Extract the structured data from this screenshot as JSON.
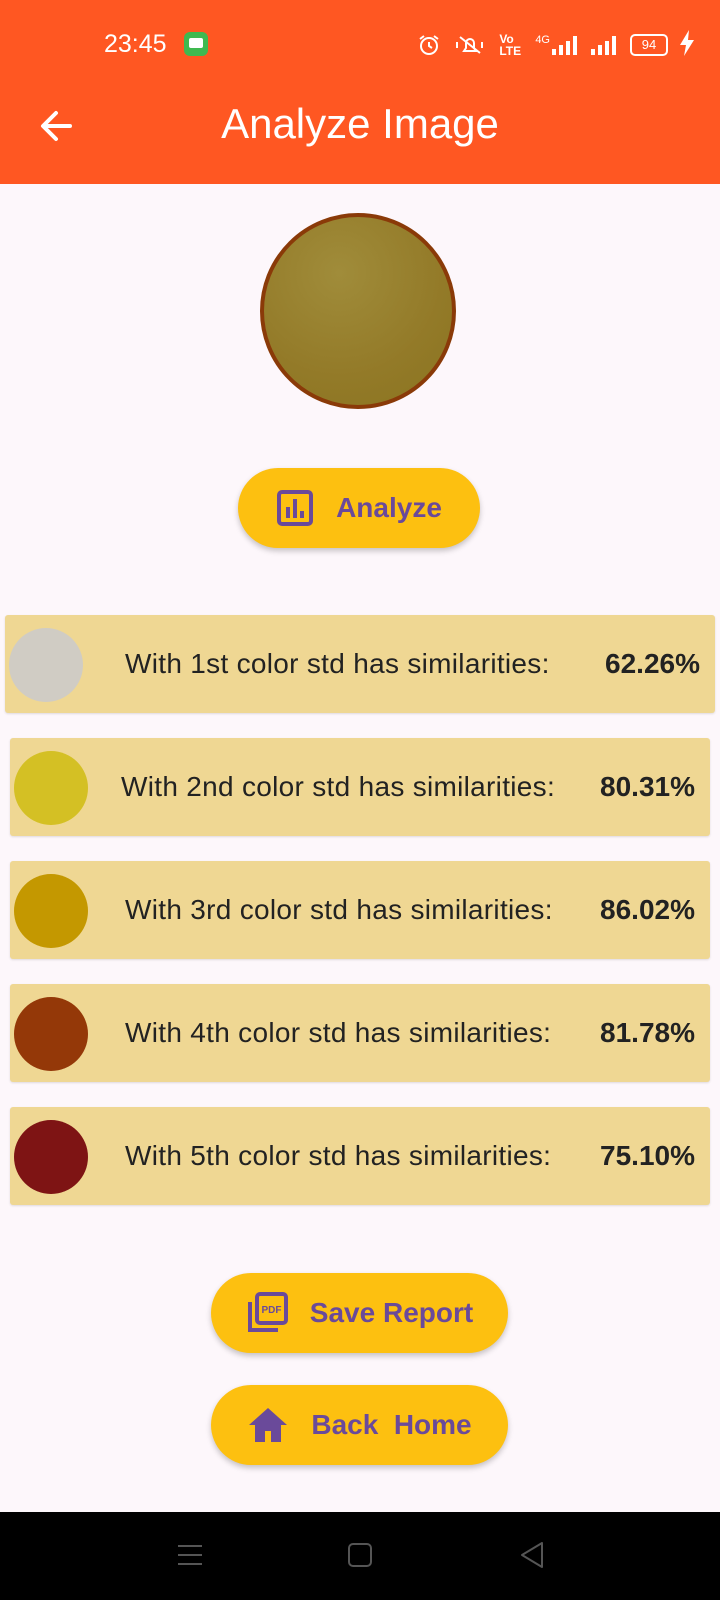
{
  "status_bar": {
    "time": "23:45",
    "icons": [
      "message-icon",
      "alarm-icon",
      "mute-icon",
      "volte-icon",
      "4g-signal-icon",
      "signal-icon",
      "battery-icon",
      "charging-icon"
    ],
    "volte_label": "Vo LTE",
    "network_label": "4G",
    "battery_level": "94"
  },
  "appbar": {
    "title": "Analyze Image",
    "back_icon": "arrow-back-icon",
    "color": "#ff5722"
  },
  "sample": {
    "color": "#96802c",
    "border_color": "#8a3a08"
  },
  "analyze_button": {
    "label": "Analyze",
    "icon": "bar-chart-icon"
  },
  "results": [
    {
      "label": "With 1st color std has similarities:",
      "value": "62.26%",
      "color": "#d0ccc4"
    },
    {
      "label": "With 2nd color std has similarities:",
      "value": "80.31%",
      "color": "#d4c024"
    },
    {
      "label": "With 3rd color std has similarities:",
      "value": "86.02%",
      "color": "#c49800"
    },
    {
      "label": "With 4th color std has similarities:",
      "value": "81.78%",
      "color": "#943808"
    },
    {
      "label": "With 5th color std has similarities:",
      "value": "75.10%",
      "color": "#7e1414"
    }
  ],
  "save_button": {
    "label": "Save Report",
    "icon": "pdf-icon",
    "icon_text": "PDF"
  },
  "home_button": {
    "label": "Back  Home",
    "icon": "home-icon"
  },
  "navigation_bar": {
    "buttons": [
      "menu-icon",
      "home-square-icon",
      "back-triangle-icon"
    ]
  },
  "colors": {
    "accent_button": "#fdc010",
    "button_text": "#6a4a9a",
    "row_background": "#efd793"
  }
}
